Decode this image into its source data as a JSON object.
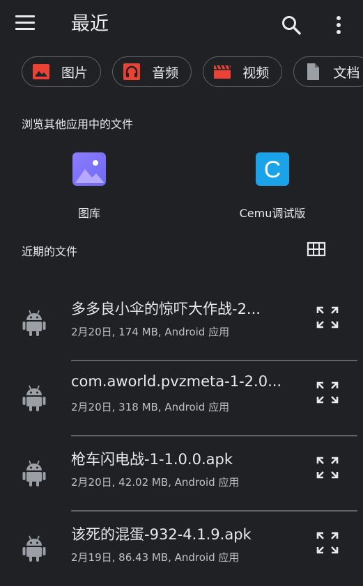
{
  "header": {
    "title": "最近"
  },
  "chips": [
    {
      "label": "图片",
      "icon": "image-icon",
      "color": "#ea4335"
    },
    {
      "label": "音频",
      "icon": "headphones-icon",
      "color": "#ea4335"
    },
    {
      "label": "视频",
      "icon": "video-clapper-icon",
      "color": "#ea4335"
    },
    {
      "label": "文档",
      "icon": "document-icon",
      "color": "#9aa0a6"
    }
  ],
  "browse": {
    "label": "浏览其他应用中的文件",
    "apps": [
      {
        "name": "图库",
        "icon": "gallery-app-icon",
        "color": "#7b6cf6"
      },
      {
        "name": "Cemu调试版",
        "icon": "cemu-app-icon",
        "color": "#1aa3e8",
        "letter": "C"
      }
    ]
  },
  "recent": {
    "label": "近期的文件",
    "files": [
      {
        "name": "多多良小伞的惊吓大作战-2...",
        "meta": "2月20日, 174 MB, Android 应用"
      },
      {
        "name": "com.aworld.pvzmeta-1-2.0...",
        "meta": "2月20日, 318 MB, Android 应用"
      },
      {
        "name": "枪车闪电战-1-1.0.0.apk",
        "meta": "2月20日, 42.02 MB, Android 应用"
      },
      {
        "name": "该死的混蛋-932-4.1.9.apk",
        "meta": "2月19日, 86.43 MB, Android 应用"
      }
    ]
  }
}
